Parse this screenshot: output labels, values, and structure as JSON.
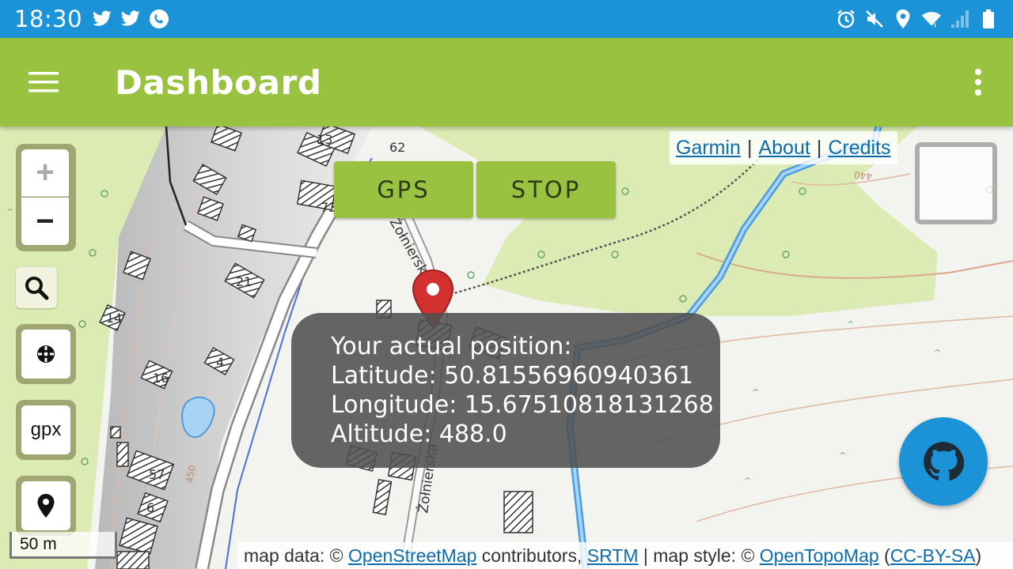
{
  "status_bar": {
    "time": "18:30",
    "left_icons": [
      "twitter-icon",
      "twitter-icon",
      "phone-call-icon"
    ],
    "right_icons": [
      "alarm-icon",
      "mute-icon",
      "location-icon",
      "wifi-icon",
      "signal-icon",
      "battery-icon"
    ]
  },
  "app_bar": {
    "title": "Dashboard",
    "menu_icon": "hamburger-menu-icon",
    "overflow_icon": "more-vert-icon"
  },
  "map": {
    "links": [
      {
        "label": "Garmin"
      },
      {
        "label": "About"
      },
      {
        "label": "Credits"
      }
    ],
    "separator": "|",
    "buttons": {
      "gps": "GPS",
      "stop": "STOP"
    },
    "zoom": {
      "in": "+",
      "out": "−"
    },
    "gpx_label": "gpx",
    "scale_label": "50 m",
    "popup": {
      "line1": "Your actual position:",
      "line2": "Latitude: 50.81556960940361",
      "line3": "Longitude: 15.67510818131268",
      "line4": "Altitude: 488.0"
    },
    "attribution": {
      "prefix": "map data: © ",
      "osm": "OpenStreetMap",
      "mid1": " contributors, ",
      "srtm": "SRTM",
      "mid2": " | map style: © ",
      "otm": "OpenTopoMap",
      "mid3": " (",
      "license": "CC-BY-SA",
      "suffix": ")"
    },
    "labels": {
      "h13": "13",
      "h62": "62",
      "h73": "73",
      "h14": "14",
      "h16": "16",
      "h4": "4",
      "h21": "21",
      "h6": "6",
      "h57": "57",
      "h450": "450",
      "h440": "440",
      "street1": "Żołnierska",
      "street2": "Żołnierska"
    }
  },
  "colors": {
    "status_bar": "#1b93d6",
    "app_bar": "#98c23f",
    "button": "#98c23f",
    "fab": "#1b93d6",
    "link": "#0d6cab",
    "forest": "#dcebb4"
  }
}
